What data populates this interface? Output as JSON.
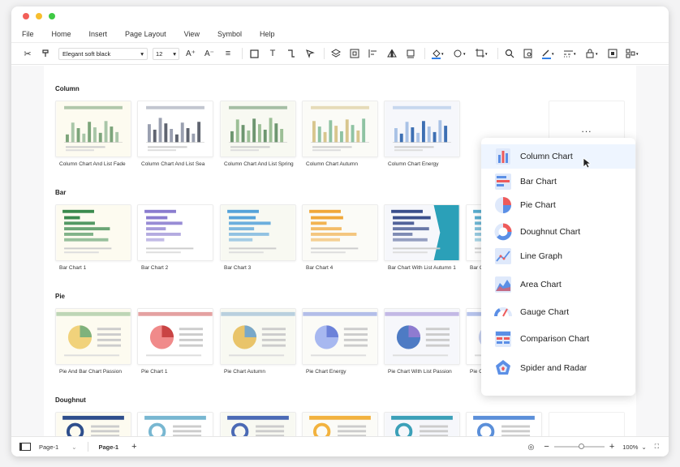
{
  "window": {
    "traffic_lights": [
      "#f25f58",
      "#f7be2e",
      "#3ec944"
    ]
  },
  "menu": [
    "File",
    "Home",
    "Insert",
    "Page Layout",
    "View",
    "Symbol",
    "Help"
  ],
  "toolbar": {
    "font_name": "Elegant soft black",
    "font_size": "12"
  },
  "sections": [
    {
      "title": "Column",
      "cards": [
        "Column Chart And List Fade",
        "Column Chart And List Sea",
        "Column Chart And List Spring",
        "Column Chart Autumn",
        "Column Chart Energy",
        ""
      ]
    },
    {
      "title": "Bar",
      "cards": [
        "Bar Chart 1",
        "Bar Chart 2",
        "Bar Chart 3",
        "Bar Chart 4",
        "Bar Chart With List Autumn 1",
        "Bar C"
      ]
    },
    {
      "title": "Pie",
      "cards": [
        "Pie And Bar Chart Passion",
        "Pie Chart 1",
        "Pie Chart Autumn",
        "Pie Chart Energy",
        "Pie Chart With List Passion",
        "Pie C"
      ]
    },
    {
      "title": "Doughnut",
      "cards": [
        "",
        "",
        "",
        "",
        "",
        ""
      ]
    }
  ],
  "more_label": "...",
  "dropdown": {
    "items": [
      {
        "label": "Column Chart",
        "icon": "column-chart-icon"
      },
      {
        "label": "Bar Chart",
        "icon": "bar-chart-icon"
      },
      {
        "label": "Pie Chart",
        "icon": "pie-chart-icon"
      },
      {
        "label": "Doughnut Chart",
        "icon": "doughnut-chart-icon"
      },
      {
        "label": "Line Graph",
        "icon": "line-graph-icon"
      },
      {
        "label": "Area Chart",
        "icon": "area-chart-icon"
      },
      {
        "label": "Gauge Chart",
        "icon": "gauge-chart-icon"
      },
      {
        "label": "Comparison Chart",
        "icon": "comparison-chart-icon"
      },
      {
        "label": "Spider and Radar",
        "icon": "spider-radar-icon"
      }
    ]
  },
  "status": {
    "page_select": "Page-1",
    "page_tab": "Page-1",
    "zoom": "100%"
  },
  "colors": {
    "accent_blue": "#2f7fe8",
    "selected_bg": "#eef5ff",
    "red": "#ee5b5b"
  }
}
